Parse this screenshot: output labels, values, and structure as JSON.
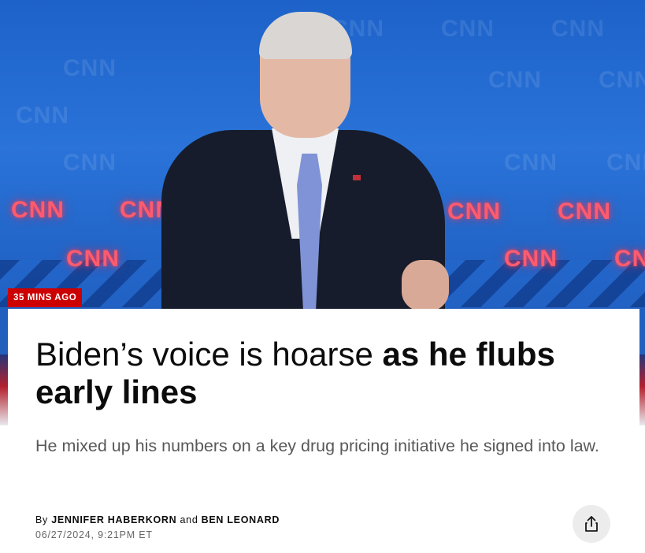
{
  "hero": {
    "logo_text": "CNN",
    "colors": {
      "backdrop": "#1f5fc0",
      "logo_glow": "#ff5b6e"
    }
  },
  "badge": {
    "text": "35 MINS AGO",
    "color": "#cc0000"
  },
  "headline": {
    "regular": "Biden’s voice is hoarse",
    "bold": "as he flubs early lines"
  },
  "dek": "He mixed up his numbers on a key drug pricing initiative he signed into law.",
  "byline": {
    "prefix": "By",
    "author1": "JENNIFER HABERKORN",
    "joiner": "and",
    "author2": "BEN LEONARD",
    "timestamp": "06/27/2024, 9:21PM ET"
  },
  "share": {
    "icon": "share-icon"
  }
}
